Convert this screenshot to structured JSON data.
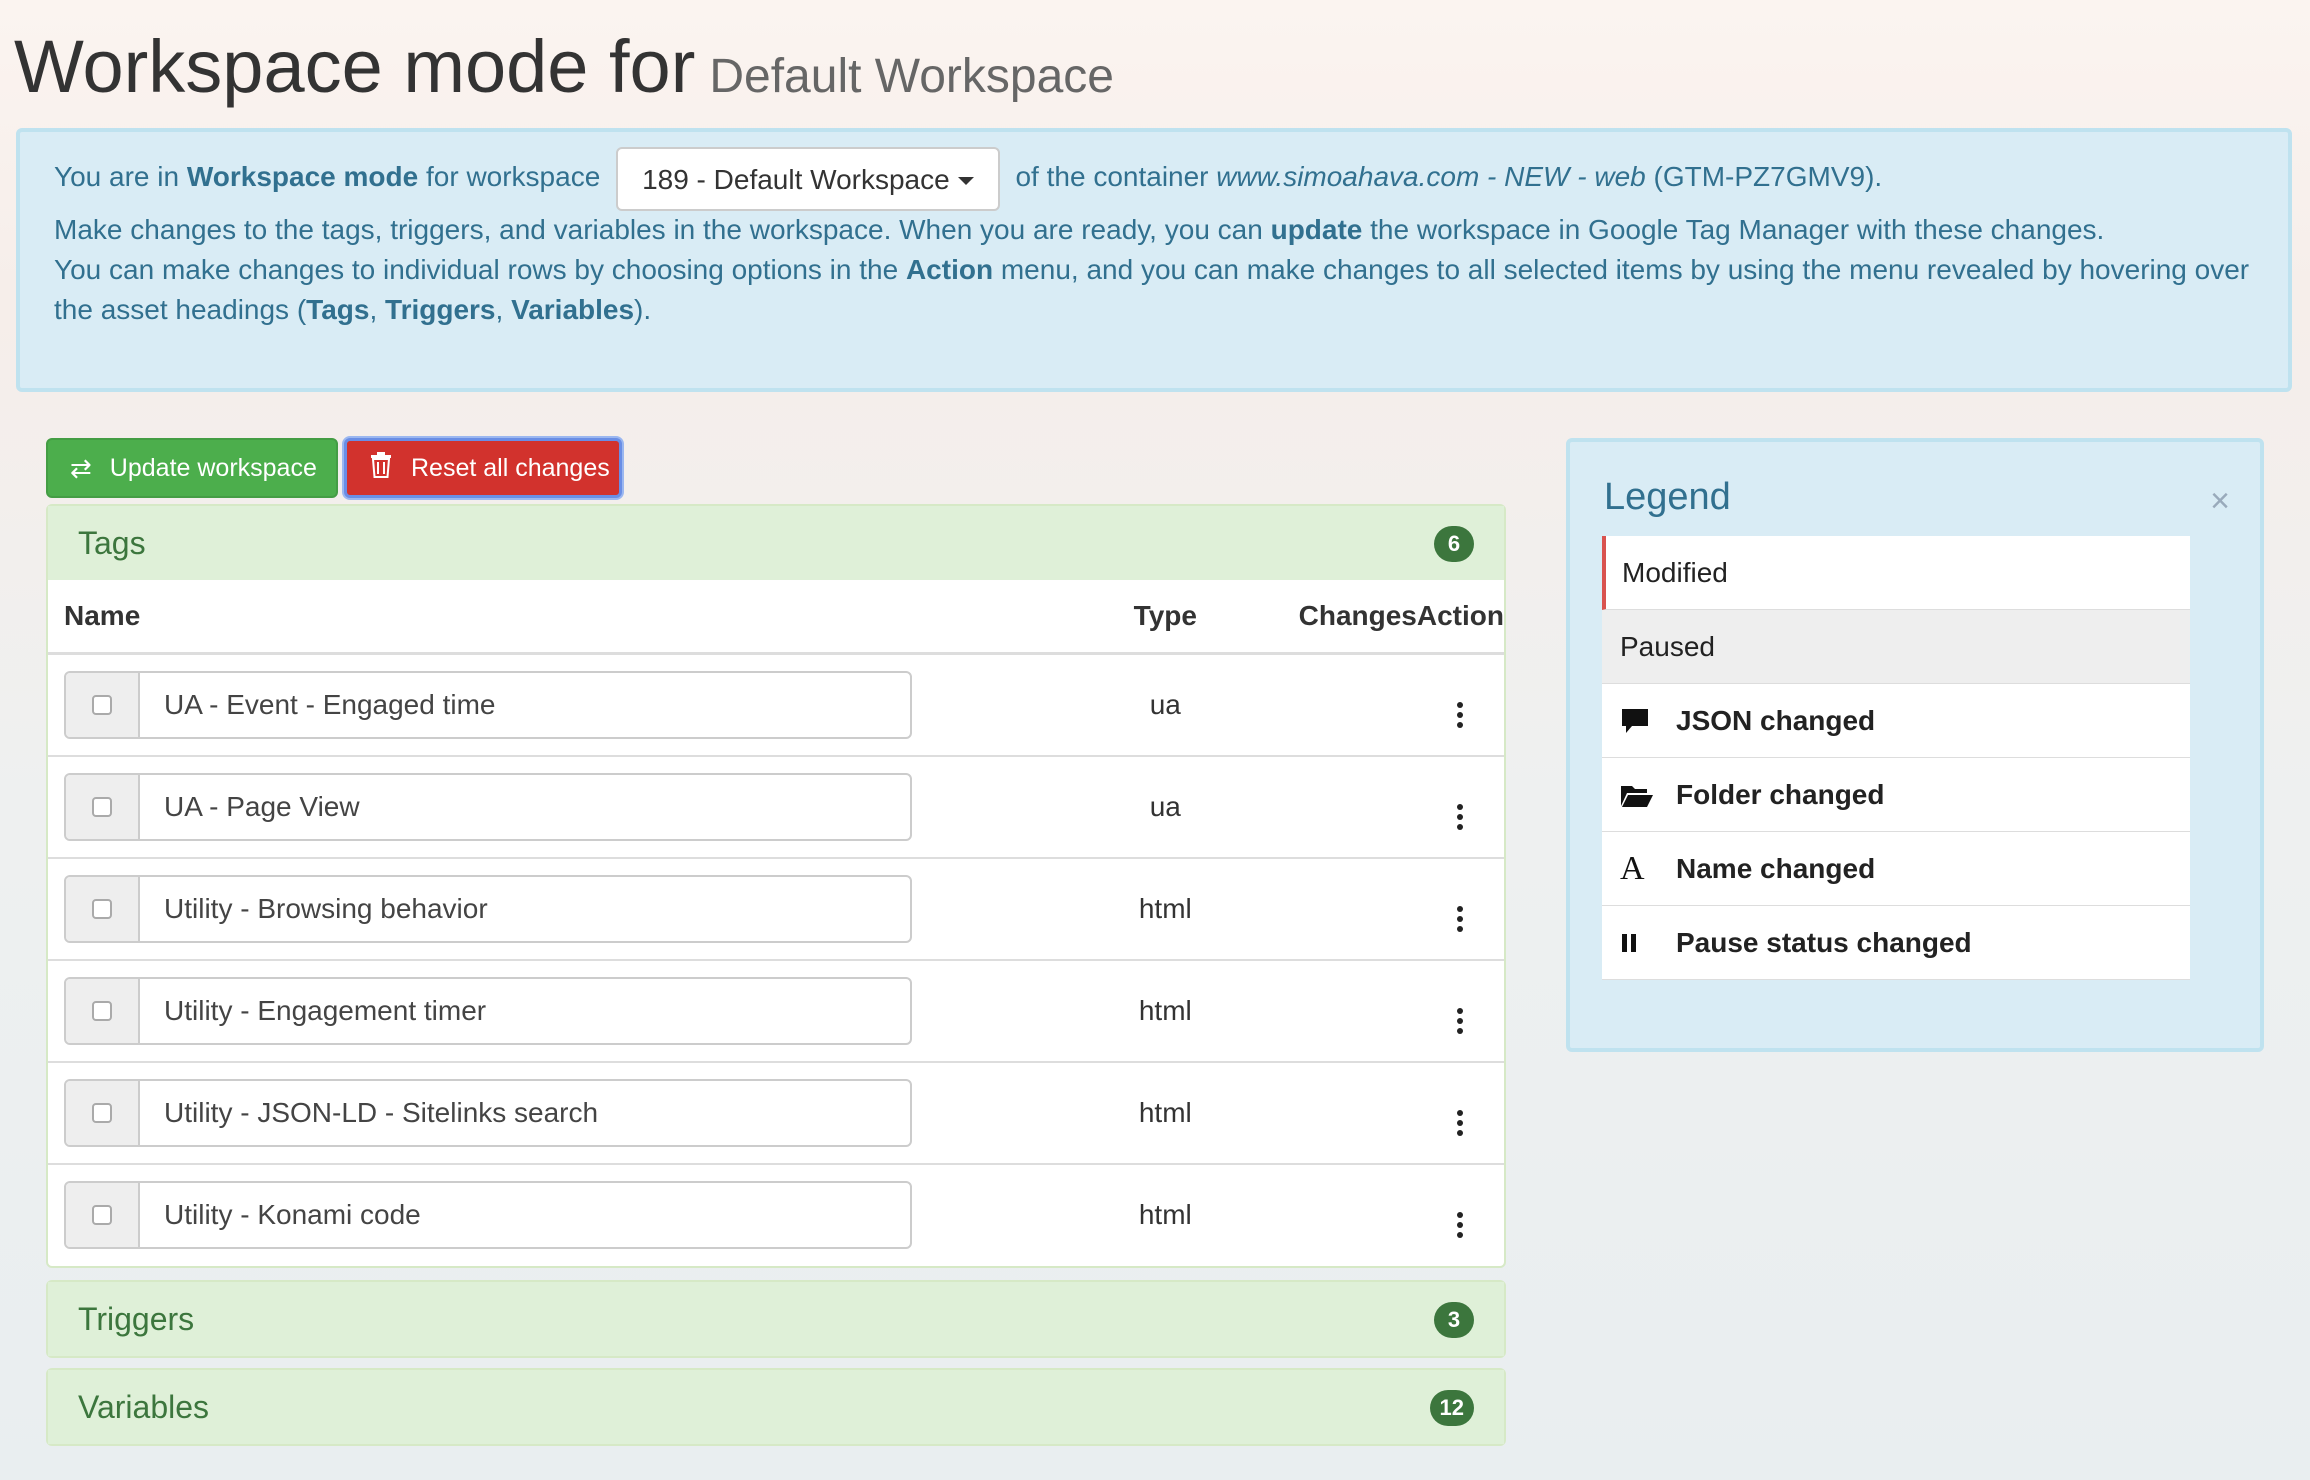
{
  "header": {
    "title": "Workspace mode for",
    "subtitle": "Default Workspace"
  },
  "info": {
    "line1_prefix": "You are in",
    "line1_mode": "Workspace mode",
    "line1_mid": "for workspace",
    "workspace_select": "189 - Default Workspace",
    "line1_container_prefix": "of the container",
    "container_name": "www.simoahava.com - NEW - web",
    "container_id": "(GTM-PZ7GMV9).",
    "line2_prefix": "Make changes to the tags, triggers, and variables in the workspace. When you are ready, you can",
    "line2_bold": "update",
    "line2_suffix": "the workspace in Google Tag Manager with these changes.",
    "line3_prefix": "You can make changes to individual rows by choosing options in the",
    "line3_bold": "Action",
    "line3_suffix": "menu, and you can make changes to all selected items by using the menu revealed by hovering over the asset headings (",
    "line3_tags": "Tags",
    "line3_sep1": ",",
    "line3_triggers": "Triggers",
    "line3_sep2": ",",
    "line3_variables": "Variables",
    "line3_end": ")."
  },
  "buttons": {
    "update": "Update workspace",
    "reset": "Reset all changes"
  },
  "tags": {
    "title": "Tags",
    "count": "6",
    "columns": {
      "name": "Name",
      "type": "Type",
      "changes": "Changes",
      "action": "Action"
    },
    "rows": [
      {
        "name": "UA - Event - Engaged time",
        "type": "ua",
        "changes": ""
      },
      {
        "name": "UA - Page View",
        "type": "ua",
        "changes": ""
      },
      {
        "name": "Utility - Browsing behavior",
        "type": "html",
        "changes": ""
      },
      {
        "name": "Utility - Engagement timer",
        "type": "html",
        "changes": ""
      },
      {
        "name": "Utility - JSON-LD - Sitelinks search",
        "type": "html",
        "changes": ""
      },
      {
        "name": "Utility - Konami code",
        "type": "html",
        "changes": ""
      }
    ]
  },
  "triggers": {
    "title": "Triggers",
    "count": "3"
  },
  "variables": {
    "title": "Variables",
    "count": "12"
  },
  "legend": {
    "title": "Legend",
    "close": "×",
    "items": [
      {
        "label": "Modified"
      },
      {
        "label": "Paused"
      },
      {
        "label": "JSON changed",
        "icon": "comment-icon"
      },
      {
        "label": "Folder changed",
        "icon": "folder-open-icon"
      },
      {
        "label": "Name changed",
        "icon": "font-icon"
      },
      {
        "label": "Pause status changed",
        "icon": "pause-icon"
      }
    ]
  },
  "colors": {
    "success": "#5cb85c",
    "danger": "#d9534f",
    "info_bg": "#d9ecf5",
    "info_text": "#31708f",
    "panel_heading": "#dff0d8",
    "panel_text": "#3c763d"
  }
}
